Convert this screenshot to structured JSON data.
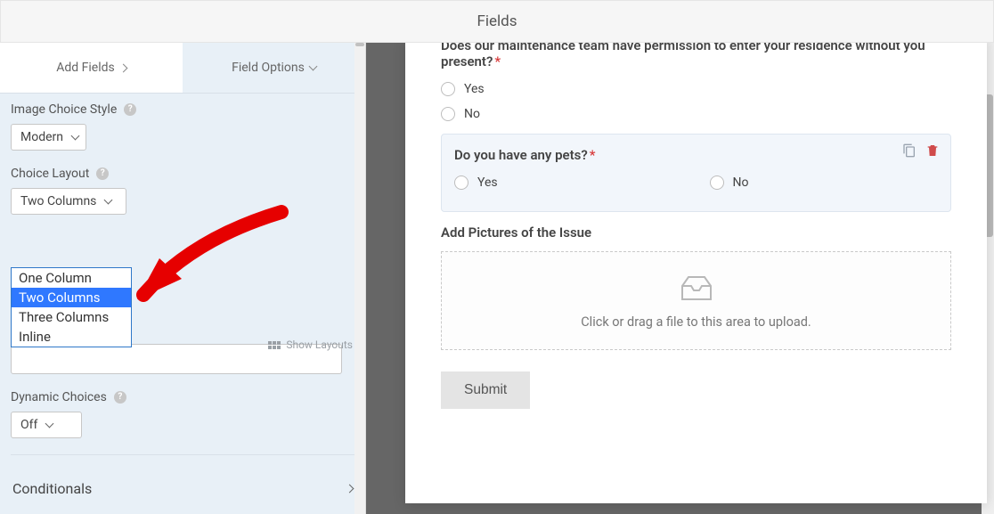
{
  "header": {
    "title": "Fields"
  },
  "tabs": {
    "add": "Add Fields",
    "options": "Field Options"
  },
  "sidebar": {
    "image_style": {
      "label": "Image Choice Style",
      "value": "Modern"
    },
    "choice_layout": {
      "label": "Choice Layout",
      "value": "Two Columns",
      "options": [
        "One Column",
        "Two Columns",
        "Three Columns",
        "Inline"
      ]
    },
    "show_layouts": "Show Layouts",
    "dynamic_choices": {
      "label": "Dynamic Choices",
      "value": "Off"
    },
    "conditionals": "Conditionals"
  },
  "form": {
    "q1": {
      "text": "Does our maintenance team have permission to enter your residence without you present?",
      "required": true,
      "opts": [
        "Yes",
        "No"
      ]
    },
    "q2": {
      "text": "Do you have any pets?",
      "required": true,
      "opts": [
        "Yes",
        "No"
      ]
    },
    "upload": {
      "label": "Add Pictures of the Issue",
      "hint": "Click or drag a file to this area to upload."
    },
    "submit": "Submit"
  }
}
